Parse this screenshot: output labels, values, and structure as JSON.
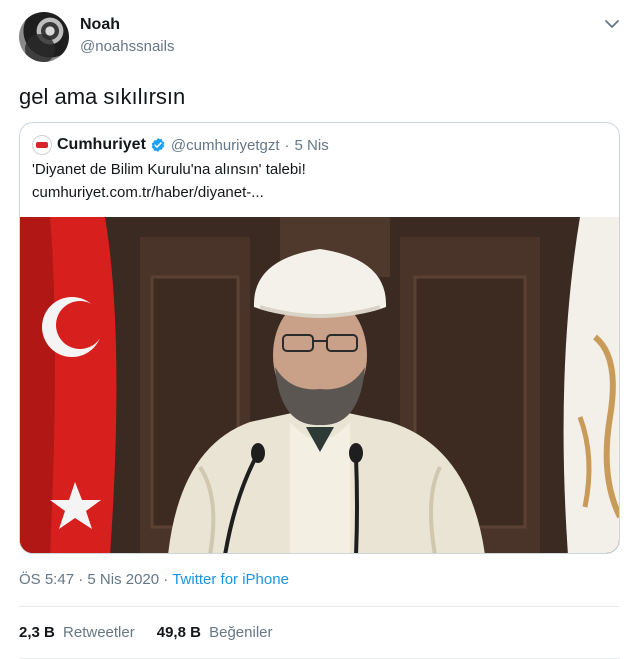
{
  "author": {
    "name": "Noah",
    "handle": "@noahssnails"
  },
  "tweet": {
    "text": "gel ama sıkılırsın"
  },
  "quoted": {
    "name": "Cumhuriyet",
    "handle": "@cumhuriyetgzt",
    "separator": "·",
    "date": "5 Nis",
    "text": "'Diyanet de Bilim Kurulu'na alınsın' talebi!",
    "link": "cumhuriyet.com.tr/haber/diyanet-..."
  },
  "meta": {
    "time": "ÖS 5:47",
    "date": "5 Nis 2020",
    "separator": "·",
    "source": "Twitter for iPhone"
  },
  "stats": [
    {
      "count": "2,3 B",
      "label": "Retweetler"
    },
    {
      "count": "49,8 B",
      "label": "Beğeniler"
    }
  ],
  "colors": {
    "link": "#1b95e0",
    "muted": "#657786",
    "verified": "#1da1f2",
    "border": "#ccd6dd"
  },
  "icons": {
    "caret": "chevron-down-icon",
    "verified": "verified-badge-icon"
  }
}
